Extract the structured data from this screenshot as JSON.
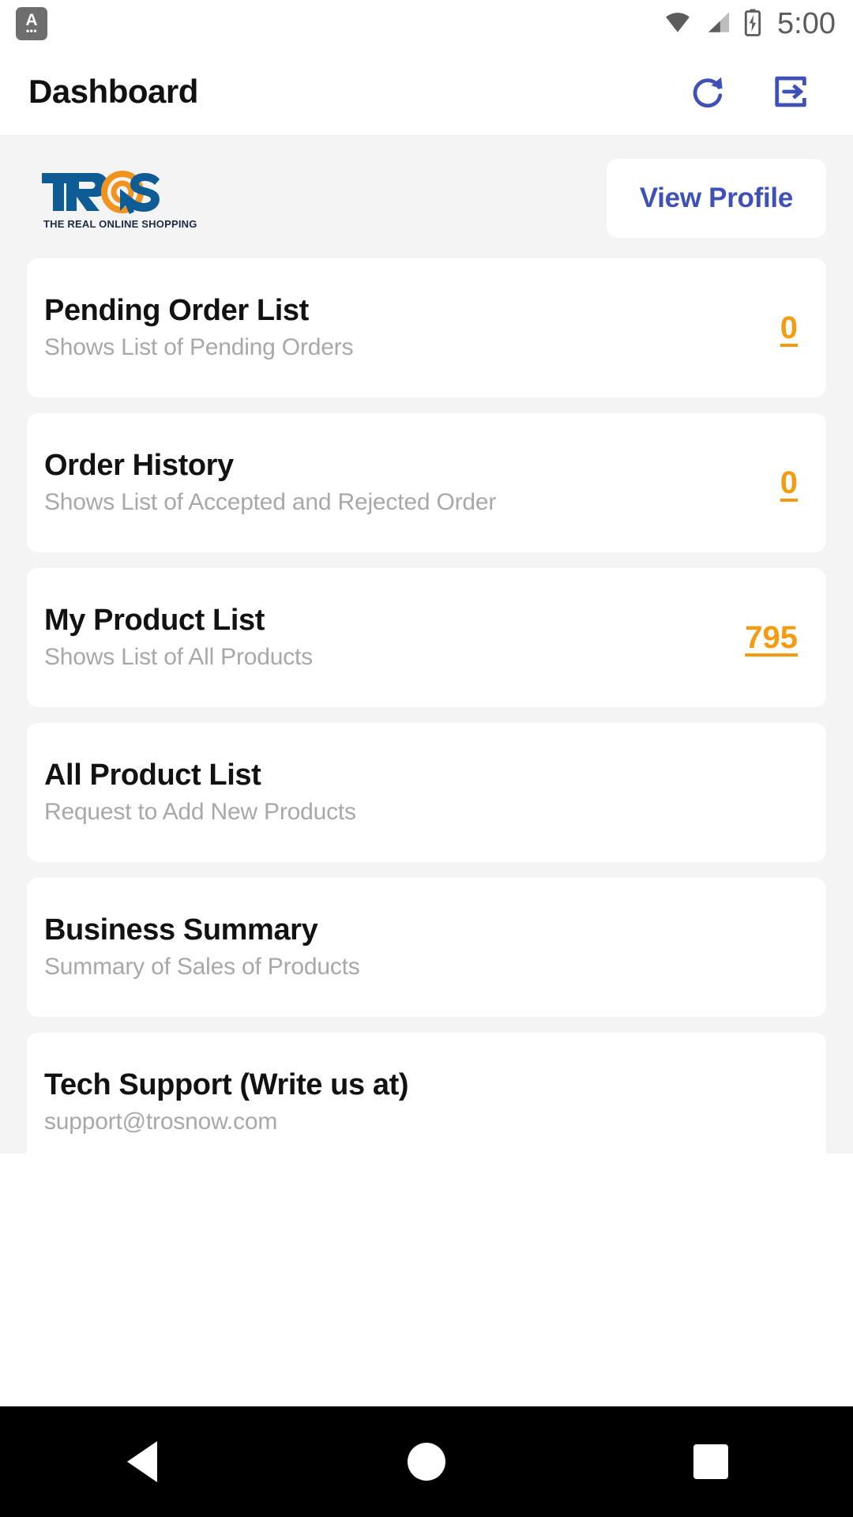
{
  "status_bar": {
    "notification_letter": "A",
    "notification_dots": "•••",
    "time": "5:00",
    "icons": [
      "wifi-icon",
      "cellular-signal-icon",
      "battery-charging-icon"
    ]
  },
  "header": {
    "title": "Dashboard",
    "actions": [
      {
        "name": "refresh-icon",
        "label": "Refresh"
      },
      {
        "name": "logout-icon",
        "label": "Logout"
      }
    ],
    "accent_color": "#3f51b5"
  },
  "brand": {
    "name": "TROS",
    "part_1": "TR",
    "part_2": "S",
    "tagline": "THE REAL ONLINE SHOPPING",
    "blue": "#0e5c96",
    "orange": "#f0941f"
  },
  "profile": {
    "view_profile_label": "View Profile"
  },
  "cards": [
    {
      "title": "Pending Order List",
      "subtitle": "Shows List of Pending Orders",
      "count": "0"
    },
    {
      "title": "Order History",
      "subtitle": "Shows List of Accepted and Rejected Order",
      "count": "0"
    },
    {
      "title": "My Product List",
      "subtitle": "Shows List of All Products",
      "count": "795"
    },
    {
      "title": "All Product List",
      "subtitle": "Request to Add New Products",
      "count": ""
    },
    {
      "title": "Business Summary",
      "subtitle": "Summary of Sales of Products",
      "count": ""
    },
    {
      "title": "Tech Support (Write us at)",
      "subtitle": "support@trosnow.com",
      "count": ""
    }
  ],
  "nav_bar": {
    "back": "back-triangle-icon",
    "home": "home-circle-icon",
    "recent": "recent-square-icon"
  },
  "colors": {
    "count_orange": "#f39c12",
    "page_background": "#f4f4f4",
    "card_background": "#ffffff",
    "subtitle_gray": "#a8a8a8"
  }
}
